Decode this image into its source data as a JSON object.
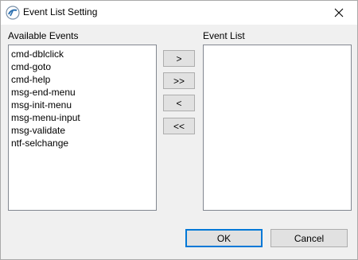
{
  "window": {
    "title": "Event List Setting"
  },
  "available": {
    "label": "Available Events",
    "items": [
      "cmd-dblclick",
      "cmd-goto",
      "cmd-help",
      "msg-end-menu",
      "msg-init-menu",
      "msg-menu-input",
      "msg-validate",
      "ntf-selchange"
    ]
  },
  "event_list": {
    "label": "Event List",
    "items": []
  },
  "move_buttons": {
    "add": ">",
    "add_all": ">>",
    "remove": "<",
    "remove_all": "<<"
  },
  "footer": {
    "ok": "OK",
    "cancel": "Cancel"
  }
}
